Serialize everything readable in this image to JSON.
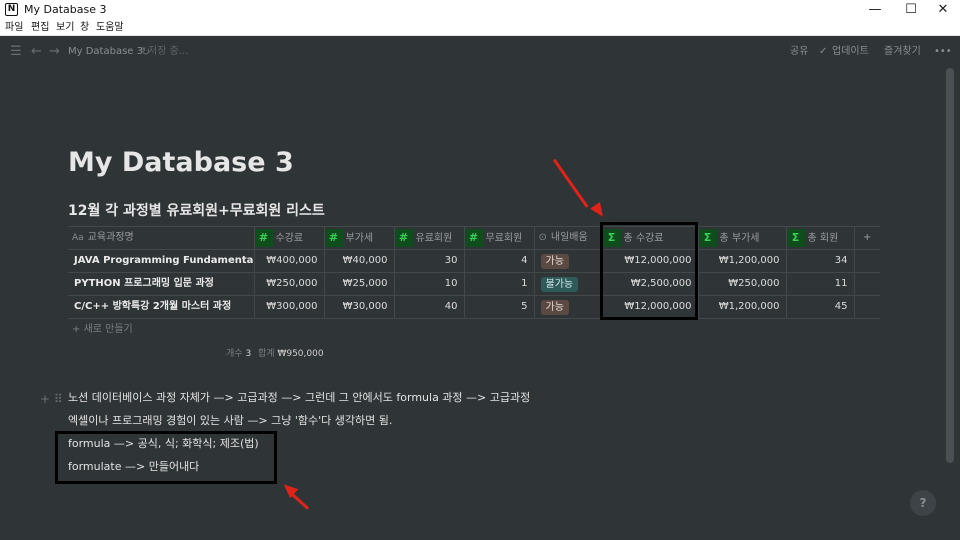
{
  "window": {
    "title": "My Database 3",
    "app_icon_glyph": "N",
    "controls": {
      "minimize": "—",
      "maximize": "☐",
      "close": "✕"
    }
  },
  "menu": {
    "items": [
      "파일",
      "편집",
      "보기",
      "창",
      "도움말"
    ]
  },
  "topbar": {
    "breadcrumb": "My Database 3",
    "saving": "저장 중...",
    "share": "공유",
    "updates": "업데이트",
    "favorite": "즐겨찾기",
    "more": "•••"
  },
  "page": {
    "title": "My Database 3",
    "database_title": "12월 각 과정별 유료회원+무료회원 리스트"
  },
  "table": {
    "columns": [
      {
        "label": "교육과정명",
        "type": "title"
      },
      {
        "label": "수강료",
        "type": "number"
      },
      {
        "label": "부가세",
        "type": "number"
      },
      {
        "label": "유료회원",
        "type": "number"
      },
      {
        "label": "무료회원",
        "type": "number"
      },
      {
        "label": "내일배움",
        "type": "select"
      },
      {
        "label": "총 수강료",
        "type": "formula"
      },
      {
        "label": "총 부가세",
        "type": "formula"
      },
      {
        "label": "총 회원",
        "type": "formula"
      }
    ],
    "rows": [
      {
        "name": "JAVA Programming Fundamental",
        "fee": "₩400,000",
        "vat": "₩40,000",
        "paid": "30",
        "free": "4",
        "naeil": "가능",
        "total_fee": "₩12,000,000",
        "total_vat": "₩1,200,000",
        "total_members": "34"
      },
      {
        "name": "PYTHON 프로그래밍 입문 과정",
        "fee": "₩250,000",
        "vat": "₩25,000",
        "paid": "10",
        "free": "1",
        "naeil": "불가능",
        "total_fee": "₩2,500,000",
        "total_vat": "₩250,000",
        "total_members": "11"
      },
      {
        "name": "C/C++ 방학특강 2개월 마스터 과정",
        "fee": "₩300,000",
        "vat": "₩30,000",
        "paid": "40",
        "free": "5",
        "naeil": "가능",
        "total_fee": "₩12,000,000",
        "total_vat": "₩1,200,000",
        "total_members": "45"
      }
    ],
    "new_row": "새로 만들기",
    "count_label": "개수",
    "count_value": "3",
    "sum_label": "합계",
    "sum_value": "₩950,000",
    "tag_colors": {
      "가능": "#5a4a43",
      "불가능": "#2f5a5a"
    }
  },
  "body": {
    "lines": [
      "노션 데이터베이스 과정 자체가 —> 고급과정 —> 그런데 그 안에서도 formula 과정 —> 고급과정",
      "엑셀이나 프로그래밍 경험이 있는 사람 —> 그냥 '함수'다 생각하면 됨.",
      "formula —> 공식, 식; 화학식; 제조(법)",
      "formulate —> 만들어내다"
    ]
  },
  "help": {
    "label": "?"
  },
  "annotation_colors": {
    "arrow": "#e02318",
    "box": "#000000"
  }
}
